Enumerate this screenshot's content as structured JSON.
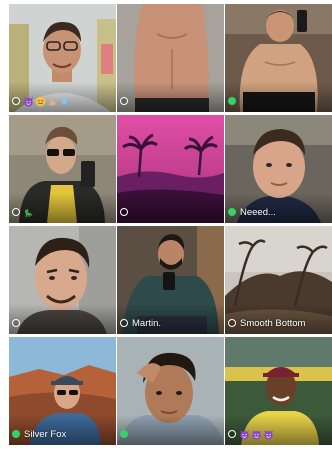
{
  "grid": {
    "profiles": [
      {
        "display_name": "",
        "status": "offline",
        "emoji_icons": [
          "devil-face-icon",
          "smiling-face-icon",
          "flexed-arm-icon",
          "splash-icon"
        ]
      },
      {
        "display_name": "",
        "status": "offline",
        "emoji_icons": []
      },
      {
        "display_name": "",
        "status": "online",
        "emoji_icons": []
      },
      {
        "display_name": "",
        "status": "offline",
        "emoji_icons": [
          "dinosaur-icon"
        ]
      },
      {
        "display_name": "",
        "status": "offline",
        "emoji_icons": []
      },
      {
        "display_name": "Neeed...",
        "status": "online",
        "emoji_icons": []
      },
      {
        "display_name": "",
        "status": "offline",
        "emoji_icons": []
      },
      {
        "display_name": "Martin.",
        "status": "offline",
        "emoji_icons": []
      },
      {
        "display_name": "Smooth Bottom",
        "status": "offline",
        "emoji_icons": []
      },
      {
        "display_name": "Silver Fox",
        "status": "online",
        "emoji_icons": []
      },
      {
        "display_name": "",
        "status": "online",
        "emoji_icons": []
      },
      {
        "display_name": "",
        "status": "offline",
        "emoji_icons": [
          "devil-face-icon",
          "devil-face-icon",
          "devil-face-icon"
        ]
      }
    ]
  },
  "colors": {
    "online": "#35d26a",
    "offline_ring": "#ffffff",
    "devil_emoji": "#8e44c7",
    "smile_emoji": "#f6c142"
  }
}
